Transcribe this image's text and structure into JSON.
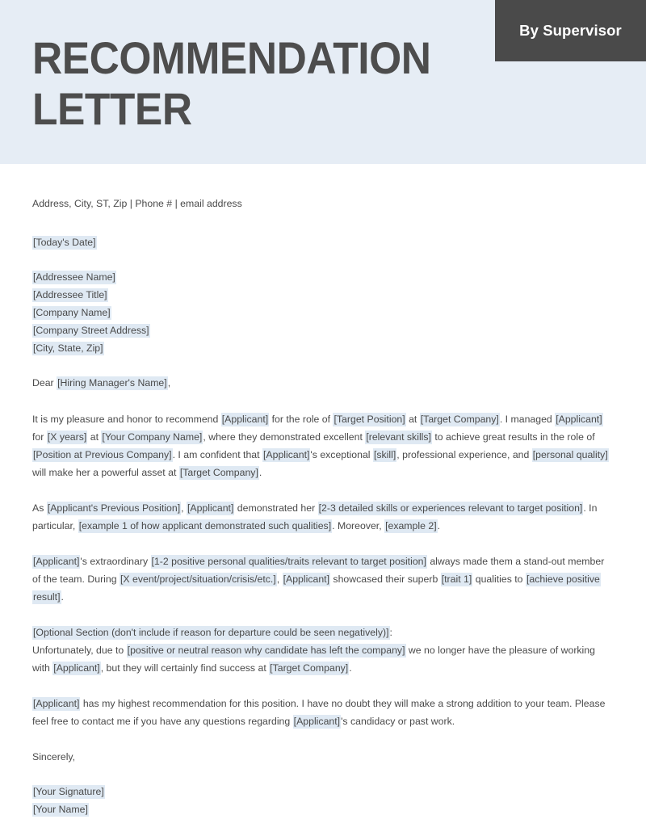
{
  "header": {
    "title": "RECOMMENDATION LETTER",
    "badge_label": "By Supervisor",
    "background_color": "#e6edf5",
    "badge_color": "#4a4a4a",
    "title_color": "#4d4d4d"
  },
  "letter": {
    "contact_line": "Address, City, ST, Zip | Phone # | email address",
    "date": "[Today's Date]",
    "addressee": [
      "[Addressee Name]",
      "[Addressee Title]",
      "[Company Name]",
      "[Company Street Address]",
      "[City, State, Zip]"
    ],
    "salutation_prefix": "Dear ",
    "salutation_placeholder": "[Hiring Manager's Name]",
    "salutation_suffix": ",",
    "paragraph_1": {
      "s1": "It is my pleasure and honor to recommend ",
      "p1": "[Applicant]",
      "s2": " for the role of ",
      "p2": "[Target Position]",
      "s3": " at ",
      "p3": "[Target Company]",
      "s4": ". I managed ",
      "p4": "[Applicant]",
      "s5": " for ",
      "p5": "[X years]",
      "s6": " at ",
      "p6": "[Your Company Name]",
      "s7": ", where they demonstrated excellent ",
      "p7": "[relevant skills]",
      "s8": " to achieve great results in the role of ",
      "p8": "[Position at Previous Company]",
      "s9": ". I am confident that ",
      "p9": "[Applicant]",
      "s10": "'s exceptional ",
      "p10": "[skill]",
      "s11": ", professional experience, and ",
      "p11": "[personal quality]",
      "s12": " will make her a powerful asset at ",
      "p12": "[Target Company]",
      "s13": "."
    },
    "paragraph_2": {
      "s1": "As ",
      "p1": "[Applicant's Previous Position]",
      "s2": ", ",
      "p2": "[Applicant]",
      "s3": " demonstrated her ",
      "p3": "[2-3 detailed skills or experiences relevant to target position]",
      "s4": ". In particular, ",
      "p4": "[example 1 of how applicant demonstrated such qualities]",
      "s5": ". Moreover, ",
      "p5": "[example 2]",
      "s6": "."
    },
    "paragraph_3": {
      "p1": "[Applicant]",
      "s1": "'s extraordinary ",
      "p2": "[1-2 positive personal qualities/traits relevant to target position]",
      "s2": " always made them a stand-out member of the team. During ",
      "p3": "[X event/project/situation/crisis/etc.]",
      "s3": ", ",
      "p4": "[Applicant]",
      "s4": " showcased their superb ",
      "p5": "[trait 1]",
      "s5": " qualities to ",
      "p6": "[achieve positive result]",
      "s6": "."
    },
    "optional_section": {
      "heading_placeholder": "[Optional Section (don't include if reason for departure could be seen negatively)]",
      "heading_suffix": ":",
      "s1": "Unfortunately, due to ",
      "p1": "[positive or neutral reason why candidate has left the company]",
      "s2": " we no longer have the pleasure of working with ",
      "p2": "[Applicant]",
      "s3": ", but they will certainly find success at ",
      "p3": "[Target Company]",
      "s4": "."
    },
    "paragraph_closing": {
      "p1": "[Applicant]",
      "s1": " has my highest recommendation for this position. I have no doubt they will make a strong addition to your team. Please feel free to contact me if you have any questions regarding ",
      "p2": "[Applicant]",
      "s2": "'s candidacy or past work."
    },
    "sign_off": "Sincerely,",
    "signature": "[Your Signature]",
    "signer_name": "[Your Name]"
  },
  "colors": {
    "highlight": "#dfe9f3",
    "text": "#4a4a4a"
  }
}
